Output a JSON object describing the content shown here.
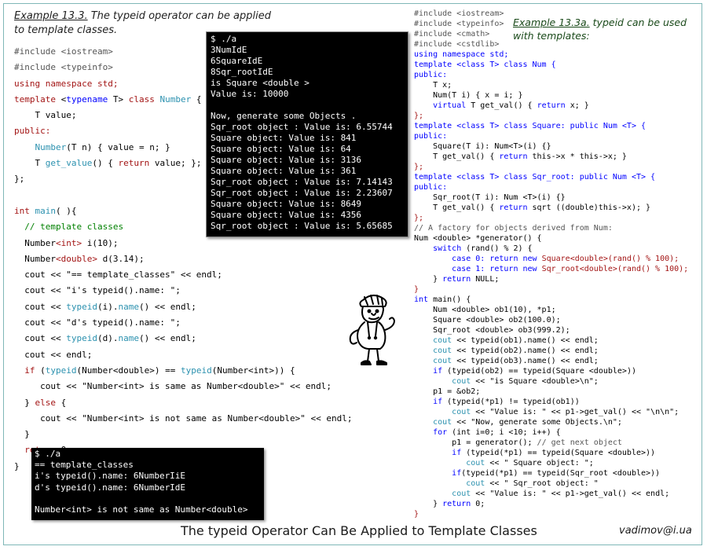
{
  "left_panel": {
    "title_example": "Example 13.3.",
    "title_text": " The typeid operator can be applied to template classes.",
    "code": [
      [
        {
          "t": "#include <iostream>",
          "c": "pp"
        }
      ],
      [
        {
          "t": "#include <typeinfo>",
          "c": "pp"
        }
      ],
      [
        {
          "t": "using namespace std;",
          "c": "st"
        }
      ],
      [
        {
          "t": "template ",
          "c": "st"
        },
        {
          "t": "<",
          "c": ""
        },
        {
          "t": "typename ",
          "c": "kw"
        },
        {
          "t": "T> ",
          "c": ""
        },
        {
          "t": "class ",
          "c": "st"
        },
        {
          "t": "Number",
          "c": "ty"
        },
        {
          "t": " {",
          "c": ""
        }
      ],
      [
        {
          "t": "    T value;",
          "c": ""
        }
      ],
      [
        {
          "t": "public:",
          "c": "st"
        }
      ],
      [
        {
          "t": "    ",
          "c": ""
        },
        {
          "t": "Number",
          "c": "ty"
        },
        {
          "t": "(T n) { value = n; }",
          "c": ""
        }
      ],
      [
        {
          "t": "    T ",
          "c": ""
        },
        {
          "t": "get_value",
          "c": "ty"
        },
        {
          "t": "() { ",
          "c": ""
        },
        {
          "t": "return",
          "c": "st"
        },
        {
          "t": " value; };",
          "c": ""
        }
      ],
      [
        {
          "t": "};",
          "c": ""
        }
      ],
      [
        {
          "t": "",
          "c": ""
        }
      ],
      [
        {
          "t": "int ",
          "c": "st"
        },
        {
          "t": "main",
          "c": "ty"
        },
        {
          "t": "( ){",
          "c": ""
        }
      ],
      [
        {
          "t": "  // template classes",
          "c": "cm"
        }
      ],
      [
        {
          "t": "  Number",
          "c": ""
        },
        {
          "t": "<int>",
          "c": "st"
        },
        {
          "t": " i(10);",
          "c": ""
        }
      ],
      [
        {
          "t": "  Number",
          "c": ""
        },
        {
          "t": "<double>",
          "c": "st"
        },
        {
          "t": " d(3.14);",
          "c": ""
        }
      ],
      [
        {
          "t": "  cout << \"== template_classes\" << endl;",
          "c": ""
        }
      ],
      [
        {
          "t": "  cout << \"i's typeid().name: \";",
          "c": ""
        }
      ],
      [
        {
          "t": "  cout << ",
          "c": ""
        },
        {
          "t": "typeid",
          "c": "ty"
        },
        {
          "t": "(i).",
          "c": ""
        },
        {
          "t": "name",
          "c": "ty"
        },
        {
          "t": "() << endl;",
          "c": ""
        }
      ],
      [
        {
          "t": "  cout << \"d's typeid().name: \";",
          "c": ""
        }
      ],
      [
        {
          "t": "  cout << ",
          "c": ""
        },
        {
          "t": "typeid",
          "c": "ty"
        },
        {
          "t": "(d).",
          "c": ""
        },
        {
          "t": "name",
          "c": "ty"
        },
        {
          "t": "() << endl;",
          "c": ""
        }
      ],
      [
        {
          "t": "  cout << endl;",
          "c": ""
        }
      ],
      [
        {
          "t": "  ",
          "c": ""
        },
        {
          "t": "if",
          "c": "st"
        },
        {
          "t": " (",
          "c": ""
        },
        {
          "t": "typeid",
          "c": "ty"
        },
        {
          "t": "(Number<double>) == ",
          "c": ""
        },
        {
          "t": "typeid",
          "c": "ty"
        },
        {
          "t": "(Number<int>)) {",
          "c": ""
        }
      ],
      [
        {
          "t": "     cout << \"Number<int> is same as Number<double>\" << endl;",
          "c": ""
        }
      ],
      [
        {
          "t": "  } ",
          "c": ""
        },
        {
          "t": "else",
          "c": "st"
        },
        {
          "t": " {",
          "c": ""
        }
      ],
      [
        {
          "t": "     cout << \"Number<int> is not same as Number<double>\" << endl;",
          "c": ""
        }
      ],
      [
        {
          "t": "  }",
          "c": ""
        }
      ],
      [
        {
          "t": "  ",
          "c": ""
        },
        {
          "t": "return",
          "c": "st"
        },
        {
          "t": " 0;",
          "c": ""
        }
      ],
      [
        {
          "t": "}",
          "c": ""
        }
      ]
    ]
  },
  "console_top": {
    "lines": [
      "$ ./a",
      "3NumIdE",
      "6SquareIdE",
      "8Sqr_rootIdE",
      "is Square <double >",
      "Value is: 10000",
      "",
      "Now, generate some Objects .",
      "Sqr_root object : Value is: 6.55744",
      "Square object: Value is: 841",
      "Square object: Value is: 64",
      "Square object: Value is: 3136",
      "Square object: Value is: 361",
      "Sqr_root object : Value is: 7.14143",
      "Sqr_root object : Value is: 2.23607",
      "Square object: Value is: 8649",
      "Square object: Value is: 4356",
      "Sqr_root object : Value is: 5.65685"
    ]
  },
  "console_bottom": {
    "lines": [
      "$ ./a",
      "== template_classes",
      "i's typeid().name: 6NumberIiE",
      "d's typeid().name: 6NumberIdE",
      "",
      "Number<int> is not same as Number<double>"
    ]
  },
  "right_panel": {
    "title_example": "Example 13.3a.",
    "title_text": " typeid can be used with templates:",
    "code": [
      [
        {
          "t": "#include <iostream>",
          "c": "pp"
        }
      ],
      [
        {
          "t": "#include <typeinfo>",
          "c": "pp"
        }
      ],
      [
        {
          "t": "#include <cmath>",
          "c": "pp"
        }
      ],
      [
        {
          "t": "#include <cstdlib>",
          "c": "pp"
        }
      ],
      [
        {
          "t": "using namespace std;",
          "c": "kw"
        }
      ],
      [
        {
          "t": "template ",
          "c": "kw"
        },
        {
          "t": "<class T> class Num {",
          "c": "kw"
        }
      ],
      [
        {
          "t": "public:",
          "c": "kw"
        }
      ],
      [
        {
          "t": "    T x;",
          "c": ""
        }
      ],
      [
        {
          "t": "    Num(T i) { x = i; }",
          "c": ""
        }
      ],
      [
        {
          "t": "    ",
          "c": ""
        },
        {
          "t": "virtual",
          "c": "kw"
        },
        {
          "t": " T get_val() { ",
          "c": ""
        },
        {
          "t": "return",
          "c": "kw"
        },
        {
          "t": " x; }",
          "c": ""
        }
      ],
      [
        {
          "t": "};",
          "c": "st"
        }
      ],
      [
        {
          "t": "template ",
          "c": "kw"
        },
        {
          "t": "<class T> class Square: public Num <T> {",
          "c": "kw"
        }
      ],
      [
        {
          "t": "public:",
          "c": "kw"
        }
      ],
      [
        {
          "t": "    Square(T i): Num<T>(i) {}",
          "c": ""
        }
      ],
      [
        {
          "t": "    T get_val() { ",
          "c": ""
        },
        {
          "t": "return",
          "c": "kw"
        },
        {
          "t": " this->x * this->x; }",
          "c": ""
        }
      ],
      [
        {
          "t": "};",
          "c": "st"
        }
      ],
      [
        {
          "t": "template ",
          "c": "kw"
        },
        {
          "t": "<class T> class Sqr_root: public Num <T> {",
          "c": "kw"
        }
      ],
      [
        {
          "t": "public:",
          "c": "kw"
        }
      ],
      [
        {
          "t": "    Sqr_root(T i): Num <T>(i) {}",
          "c": ""
        }
      ],
      [
        {
          "t": "    T get_val() { ",
          "c": ""
        },
        {
          "t": "return",
          "c": "kw"
        },
        {
          "t": " sqrt ((double)this->x); }",
          "c": ""
        }
      ],
      [
        {
          "t": "};",
          "c": "st"
        }
      ],
      [
        {
          "t": "// A factory for objects derived from Num:",
          "c": "pp"
        }
      ],
      [
        {
          "t": "Num <double> *generator() {",
          "c": ""
        }
      ],
      [
        {
          "t": "    ",
          "c": ""
        },
        {
          "t": "switch",
          "c": "kw"
        },
        {
          "t": " (rand() % 2) {",
          "c": ""
        }
      ],
      [
        {
          "t": "        ",
          "c": ""
        },
        {
          "t": "case 0: return new",
          "c": "kw"
        },
        {
          "t": " Square<double>(rand() % 100);",
          "c": "st"
        }
      ],
      [
        {
          "t": "        ",
          "c": ""
        },
        {
          "t": "case 1: return new",
          "c": "kw"
        },
        {
          "t": " Sqr_root<double>(rand() % 100);",
          "c": "st"
        }
      ],
      [
        {
          "t": "    } ",
          "c": ""
        },
        {
          "t": "return",
          "c": "kw"
        },
        {
          "t": " NULL;",
          "c": ""
        }
      ],
      [
        {
          "t": "}",
          "c": "st"
        }
      ],
      [
        {
          "t": "int",
          "c": "kw"
        },
        {
          "t": " main() {",
          "c": ""
        }
      ],
      [
        {
          "t": "    Num <double> ob1(10), *p1;",
          "c": ""
        }
      ],
      [
        {
          "t": "    Square <double> ob2(100.0);",
          "c": ""
        }
      ],
      [
        {
          "t": "    Sqr_root <double> ob3(999.2);",
          "c": ""
        }
      ],
      [
        {
          "t": "    ",
          "c": ""
        },
        {
          "t": "cout",
          "c": "ty"
        },
        {
          "t": " << typeid(ob1).name() << endl;",
          "c": ""
        }
      ],
      [
        {
          "t": "    ",
          "c": ""
        },
        {
          "t": "cout",
          "c": "ty"
        },
        {
          "t": " << typeid(ob2).name() << endl;",
          "c": ""
        }
      ],
      [
        {
          "t": "    ",
          "c": ""
        },
        {
          "t": "cout",
          "c": "ty"
        },
        {
          "t": " << typeid(ob3).name() << endl;",
          "c": ""
        }
      ],
      [
        {
          "t": "    ",
          "c": ""
        },
        {
          "t": "if",
          "c": "kw"
        },
        {
          "t": " (typeid(ob2) == typeid(Square <double>))",
          "c": ""
        }
      ],
      [
        {
          "t": "        ",
          "c": ""
        },
        {
          "t": "cout",
          "c": "ty"
        },
        {
          "t": " << \"is Square <double>\\n\";",
          "c": ""
        }
      ],
      [
        {
          "t": "    p1 = &ob2;",
          "c": ""
        }
      ],
      [
        {
          "t": "    ",
          "c": ""
        },
        {
          "t": "if",
          "c": "kw"
        },
        {
          "t": " (typeid(*p1) != typeid(ob1))",
          "c": ""
        }
      ],
      [
        {
          "t": "        ",
          "c": ""
        },
        {
          "t": "cout",
          "c": "ty"
        },
        {
          "t": " << \"Value is: \" << p1->get_val() << \"\\n\\n\";",
          "c": ""
        }
      ],
      [
        {
          "t": "    ",
          "c": ""
        },
        {
          "t": "cout",
          "c": "ty"
        },
        {
          "t": " << \"Now, generate some Objects.\\n\";",
          "c": ""
        }
      ],
      [
        {
          "t": "    ",
          "c": ""
        },
        {
          "t": "for",
          "c": "kw"
        },
        {
          "t": " (int i=0; i <10; i++) {",
          "c": ""
        }
      ],
      [
        {
          "t": "        p1 = generator(); ",
          "c": ""
        },
        {
          "t": "// get next object",
          "c": "pp"
        }
      ],
      [
        {
          "t": "        ",
          "c": ""
        },
        {
          "t": "if",
          "c": "kw"
        },
        {
          "t": " (typeid(*p1) == typeid(Square <double>))",
          "c": ""
        }
      ],
      [
        {
          "t": "           ",
          "c": ""
        },
        {
          "t": "cout",
          "c": "ty"
        },
        {
          "t": " << \" Square object: \";",
          "c": ""
        }
      ],
      [
        {
          "t": "        ",
          "c": ""
        },
        {
          "t": "if",
          "c": "kw"
        },
        {
          "t": "(typeid(*p1) == typeid(Sqr_root <double>))",
          "c": ""
        }
      ],
      [
        {
          "t": "           ",
          "c": ""
        },
        {
          "t": "cout",
          "c": "ty"
        },
        {
          "t": " << \" Sqr_root object: \"",
          "c": ""
        }
      ],
      [
        {
          "t": "        ",
          "c": ""
        },
        {
          "t": "cout",
          "c": "ty"
        },
        {
          "t": " << \"Value is: \" << p1->get_val() << endl;",
          "c": ""
        }
      ],
      [
        {
          "t": "    } ",
          "c": ""
        },
        {
          "t": "return",
          "c": "kw"
        },
        {
          "t": " 0;",
          "c": ""
        }
      ],
      [
        {
          "t": "}",
          "c": "st"
        }
      ]
    ]
  },
  "footer": {
    "caption": "The typeid Operator Can Be Applied to Template Classes",
    "email": "vadimov@i.ua"
  },
  "mascot": {
    "icon": "cartoon-man-icon"
  }
}
